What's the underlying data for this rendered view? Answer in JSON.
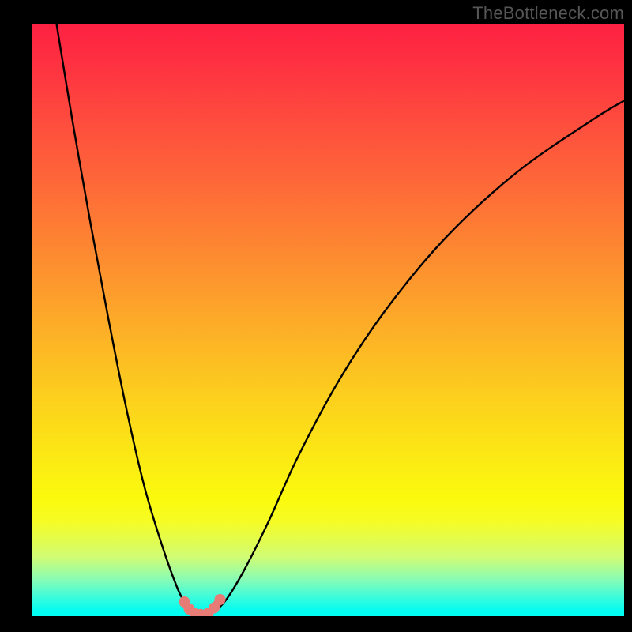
{
  "watermark": "TheBottleneck.com",
  "chart_data": {
    "type": "line",
    "title": "",
    "xlabel": "",
    "ylabel": "",
    "x_range_fraction": [
      0,
      1
    ],
    "y_range_percent": [
      0,
      100
    ],
    "left_curve": {
      "description": "steep descending branch from top-left into the valley",
      "x_fraction": [
        0.042,
        0.07,
        0.1,
        0.13,
        0.16,
        0.19,
        0.22,
        0.245,
        0.26,
        0.27
      ],
      "y_percent": [
        100,
        83,
        66,
        50,
        35,
        22,
        12,
        5,
        2,
        0.8
      ]
    },
    "right_curve": {
      "description": "rising branch from the valley curving toward upper-right",
      "x_fraction": [
        0.31,
        0.33,
        0.36,
        0.4,
        0.45,
        0.52,
        0.6,
        0.7,
        0.82,
        0.95,
        1.0
      ],
      "y_percent": [
        0.8,
        3,
        8,
        16,
        27,
        40,
        52,
        64,
        75,
        84,
        87
      ]
    },
    "valley_markers": {
      "description": "salmon U-shaped marker cluster at curve minimum",
      "color": "#e77b75",
      "x_fraction": [
        0.258,
        0.266,
        0.275,
        0.285,
        0.298,
        0.308,
        0.318
      ],
      "y_percent": [
        2.4,
        1.2,
        0.5,
        0.3,
        0.5,
        1.4,
        2.8
      ]
    },
    "gradient_stops_percent_from_top_to_color": [
      [
        0,
        "#fd2141"
      ],
      [
        16,
        "#fe4b3e"
      ],
      [
        40,
        "#fd8d30"
      ],
      [
        64,
        "#fcd21c"
      ],
      [
        80,
        "#fbfa0d"
      ],
      [
        94,
        "#84fcb8"
      ],
      [
        100,
        "#02fcf1"
      ]
    ]
  }
}
